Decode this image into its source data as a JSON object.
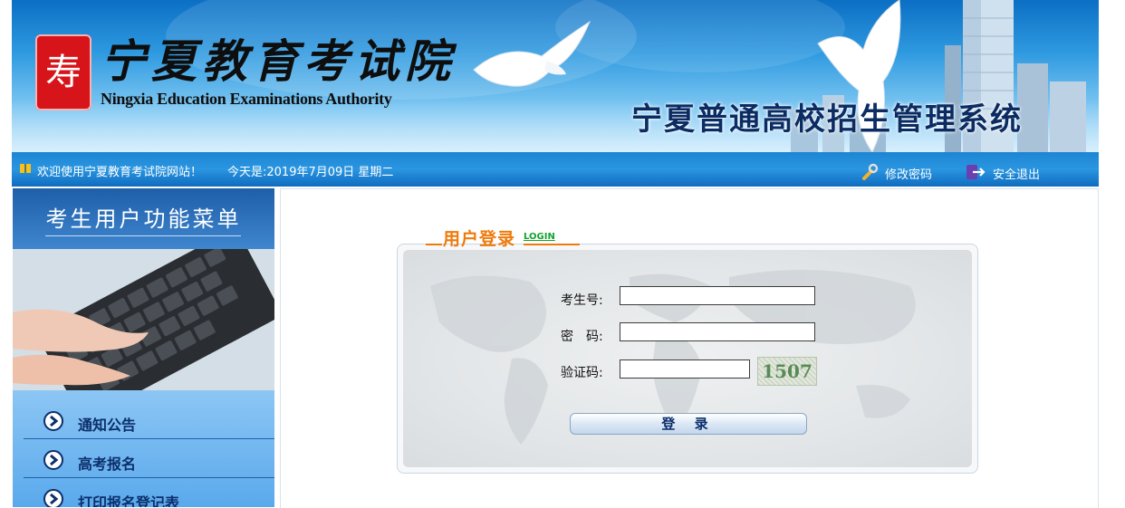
{
  "header": {
    "logo_seal_char": "寿",
    "logo_cn": "宁夏教育考试院",
    "logo_en": "Ningxia Education Examinations Authority",
    "system_title": "宁夏普通高校招生管理系统"
  },
  "infobar": {
    "welcome": "欢迎使用宁夏教育考试院网站！",
    "date_text": "今天是:2019年7月09日 星期二",
    "change_password": "修改密码",
    "logout": "安全退出"
  },
  "sidebar": {
    "title": "考生用户功能菜单",
    "items": [
      {
        "label": "通知公告"
      },
      {
        "label": "高考报名"
      },
      {
        "label": "打印报名登记表"
      }
    ]
  },
  "login": {
    "title": "用户登录",
    "subtitle": "LOGIN",
    "fields": {
      "exam_id_label": "考生号:",
      "exam_id_value": "",
      "password_label": "密　码:",
      "password_value": "",
      "captcha_label": "验证码:",
      "captcha_value": ""
    },
    "captcha_code": "1507",
    "submit_label": "登 录"
  },
  "colors": {
    "banner_blue": "#1d86d4",
    "sidebar_blue": "#5aa9ec",
    "login_title_orange": "#ef7a0a",
    "login_sub_green": "#16a230",
    "menu_text": "#0c2f6b"
  },
  "icons": [
    "welcome-book-icon",
    "wrench-icon",
    "exit-icon",
    "chevron-right-circle-icon"
  ]
}
